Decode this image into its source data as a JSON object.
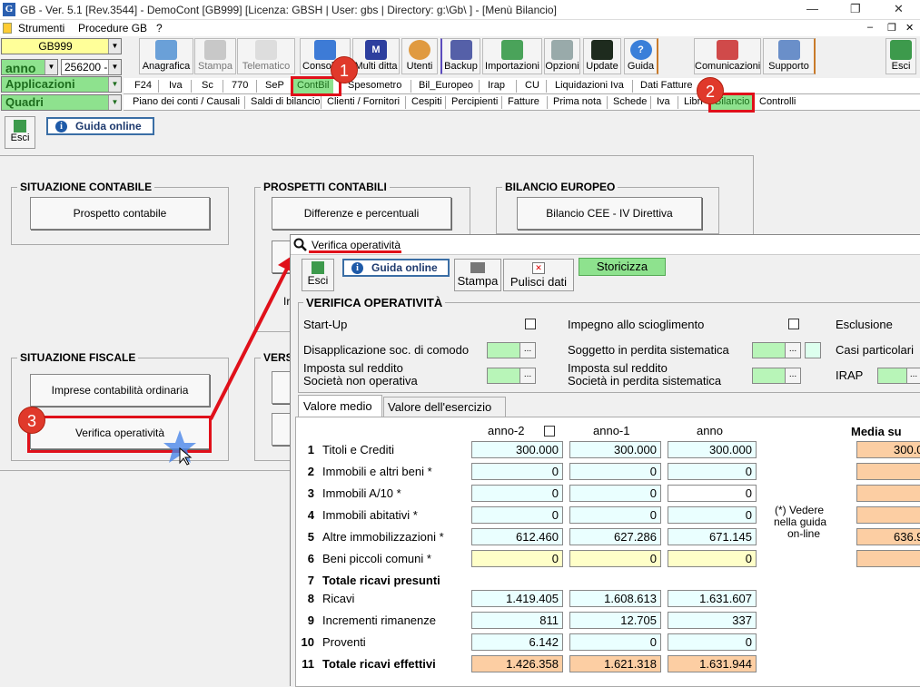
{
  "window": {
    "title": "GB - Ver. 5.1 [Rev.3544] -  DemoCont [GB999]   [Licenza: GBSH | User: gbs | Directory: g:\\Gb\\ ] - [Menù Bilancio]"
  },
  "menu": [
    "Strumenti",
    "Procedure GB",
    "?"
  ],
  "combos": {
    "company": "GB999",
    "period_type": "anno",
    "period_value": "256200 -",
    "app_menu": "Applicazioni",
    "quadri": "Quadri"
  },
  "toolbar": [
    "Anagrafica",
    "Stampa",
    "Telematico",
    "Console T",
    "Multi ditta",
    "Utenti",
    "Backup",
    "Importazioni",
    "Opzioni",
    "Update",
    "Guida",
    "Comunicazioni",
    "Supporto",
    "Esci"
  ],
  "tabs_row1": [
    "F24",
    "Iva",
    "Sc",
    "770",
    "SeP",
    "ContBil",
    "Spesometro",
    "Bil_Europeo",
    "Irap",
    "CU",
    "Liquidazioni Iva",
    "Dati Fatture"
  ],
  "tabs_row2": [
    "Piano dei conti / Causali",
    "Saldi di bilancio",
    "Clienti / Fornitori",
    "Cespiti",
    "Percipienti",
    "Fatture",
    "Prima nota",
    "Schede",
    "Iva",
    "Libri",
    "Bilancio",
    "Controlli"
  ],
  "main": {
    "exit": "Esci",
    "guide": "Guida online",
    "groups": {
      "situazione_contabile": {
        "title": "SITUAZIONE CONTABILE",
        "button": "Prospetto contabile"
      },
      "prospetti_contabili": {
        "title": "PROSPETTI CONTABILI",
        "button": "Differenze e percentuali",
        "partial": "Ir"
      },
      "bilancio_europeo": {
        "title": "BILANCIO EUROPEO",
        "button": "Bilancio CEE - IV Direttiva"
      },
      "situazione_fiscale": {
        "title": "SITUAZIONE FISCALE",
        "button1": "Imprese contabilità ordinaria",
        "button2": "Verifica operatività"
      },
      "vers": {
        "title": "VERS"
      }
    }
  },
  "annotations": {
    "b1": "1",
    "b2": "2",
    "b3": "3"
  },
  "dialog": {
    "title": "Verifica operatività",
    "buttons": {
      "exit": "Esci",
      "guide": "Guida online",
      "print": "Stampa",
      "clear": "Pulisci dati",
      "history": "Storicizza"
    },
    "section": "VERIFICA OPERATIVITÀ",
    "fields": {
      "startup": "Start-Up",
      "impegno": "Impegno allo scioglimento",
      "esclusione": "Esclusione",
      "disapplicazione": "Disapplicazione soc. di comodo",
      "soggetto": "Soggetto in perdita sistematica",
      "casi": "Casi particolari",
      "imposta1a": "Imposta sul reddito",
      "imposta1b": "Società non operativa",
      "imposta2a": "Imposta sul reddito",
      "imposta2b": "Società in perdita sistematica",
      "irap": "IRAP",
      "dots": "..."
    },
    "tabs": [
      "Valore medio",
      "Valore dell'esercizio"
    ],
    "columns": {
      "c1": "anno-2",
      "c2": "anno-1",
      "c3": "anno",
      "c4": "Media su"
    },
    "note": [
      "(*) Vedere",
      "nella guida",
      "on-line"
    ],
    "rows": [
      {
        "n": "1",
        "label": "Titoli e Crediti",
        "v": [
          "300.000",
          "300.000",
          "300.000"
        ],
        "m": "300.0"
      },
      {
        "n": "2",
        "label": "Immobili e altri beni *",
        "v": [
          "0",
          "0",
          "0"
        ],
        "m": ""
      },
      {
        "n": "3",
        "label": "Immobili A/10 *",
        "v": [
          "0",
          "0",
          "0"
        ],
        "m": ""
      },
      {
        "n": "4",
        "label": "Immobili abitativi *",
        "v": [
          "0",
          "0",
          "0"
        ],
        "m": ""
      },
      {
        "n": "5",
        "label": "Altre immobilizzazioni *",
        "v": [
          "612.460",
          "627.286",
          "671.145"
        ],
        "m": "636.9"
      },
      {
        "n": "6",
        "label": "Beni piccoli comuni *",
        "v": [
          "0",
          "0",
          "0"
        ],
        "m": ""
      },
      {
        "n": "7",
        "label": "Totale ricavi presunti",
        "v": [],
        "m": ""
      },
      {
        "n": "8",
        "label": "Ricavi",
        "v": [
          "1.419.405",
          "1.608.613",
          "1.631.607"
        ],
        "m": ""
      },
      {
        "n": "9",
        "label": "Incrementi rimanenze",
        "v": [
          "811",
          "12.705",
          "337"
        ],
        "m": ""
      },
      {
        "n": "10",
        "label": "Proventi",
        "v": [
          "6.142",
          "0",
          "0"
        ],
        "m": ""
      },
      {
        "n": "11",
        "label": "Totale ricavi effettivi",
        "v": [
          "1.426.358",
          "1.621.318",
          "1.631.944"
        ],
        "m": ""
      }
    ]
  }
}
